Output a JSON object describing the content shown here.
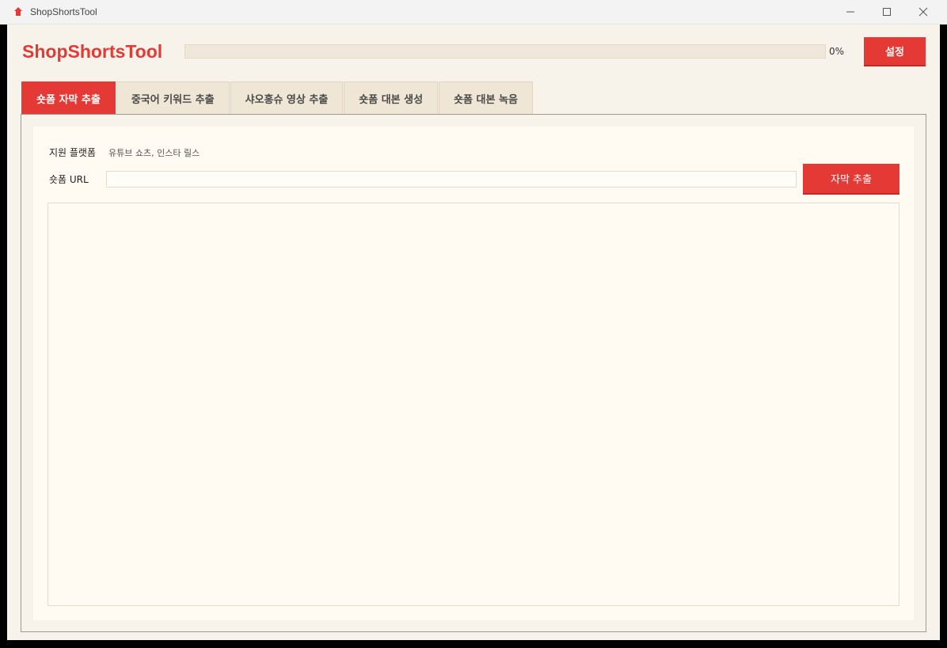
{
  "window": {
    "title": "ShopShortsTool"
  },
  "header": {
    "app_title": "ShopShortsTool",
    "progress_value": 0,
    "progress_text": "0%",
    "settings_label": "설정"
  },
  "tabs": [
    {
      "label": "숏폼 자막 추출",
      "active": true
    },
    {
      "label": "중국어 키워드 추출",
      "active": false
    },
    {
      "label": "샤오홍슈 영상 추출",
      "active": false
    },
    {
      "label": "숏폼 대본 생성",
      "active": false
    },
    {
      "label": "숏폼 대본 녹음",
      "active": false
    }
  ],
  "main": {
    "platform_label": "지원 플랫폼",
    "platform_value": "유튜브 쇼츠, 인스타 릴스",
    "url_label": "숏폼 URL",
    "url_value": "",
    "extract_label": "자막 추출",
    "output_text": ""
  },
  "colors": {
    "accent": "#e53935",
    "background": "#f8f3ea",
    "card": "#fffbf3"
  }
}
